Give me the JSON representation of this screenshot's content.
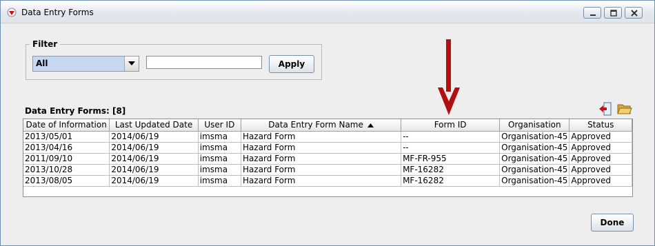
{
  "window": {
    "title": "Data Entry Forms",
    "controls": [
      "minimize-icon",
      "maximize-icon",
      "close-icon"
    ]
  },
  "filter": {
    "legend": "Filter",
    "select_value": "All",
    "text_value": "",
    "apply_label": "Apply"
  },
  "annotation": {
    "arrow_color": "#b01010"
  },
  "table": {
    "caption": "Data Entry Forms: [8]",
    "columns": [
      "Date of Information",
      "Last Updated Date",
      "User ID",
      "Data Entry Form Name",
      "Form ID",
      "Organisation",
      "Status"
    ],
    "sorted_column": "Data Entry Form Name",
    "sort_direction": "ascending",
    "rows": [
      [
        "2013/05/01",
        "2014/06/19",
        "imsma",
        "Hazard Form",
        "--",
        "Organisation-45",
        "Approved"
      ],
      [
        "2013/04/16",
        "2014/06/19",
        "imsma",
        "Hazard Form",
        "--",
        "Organisation-45",
        "Approved"
      ],
      [
        "2011/09/10",
        "2014/06/19",
        "imsma",
        "Hazard Form",
        "MF-FR-955",
        "Organisation-45",
        "Approved"
      ],
      [
        "2013/10/28",
        "2014/06/19",
        "imsma",
        "Hazard Form",
        "MF-16282",
        "Organisation-45",
        "Approved"
      ],
      [
        "2013/08/05",
        "2014/06/19",
        "imsma",
        "Hazard Form",
        "MF-16282",
        "Organisation-45",
        "Approved"
      ]
    ]
  },
  "toolbar": {
    "icons": [
      "export-icon",
      "open-folder-icon"
    ]
  },
  "footer": {
    "done_label": "Done"
  }
}
